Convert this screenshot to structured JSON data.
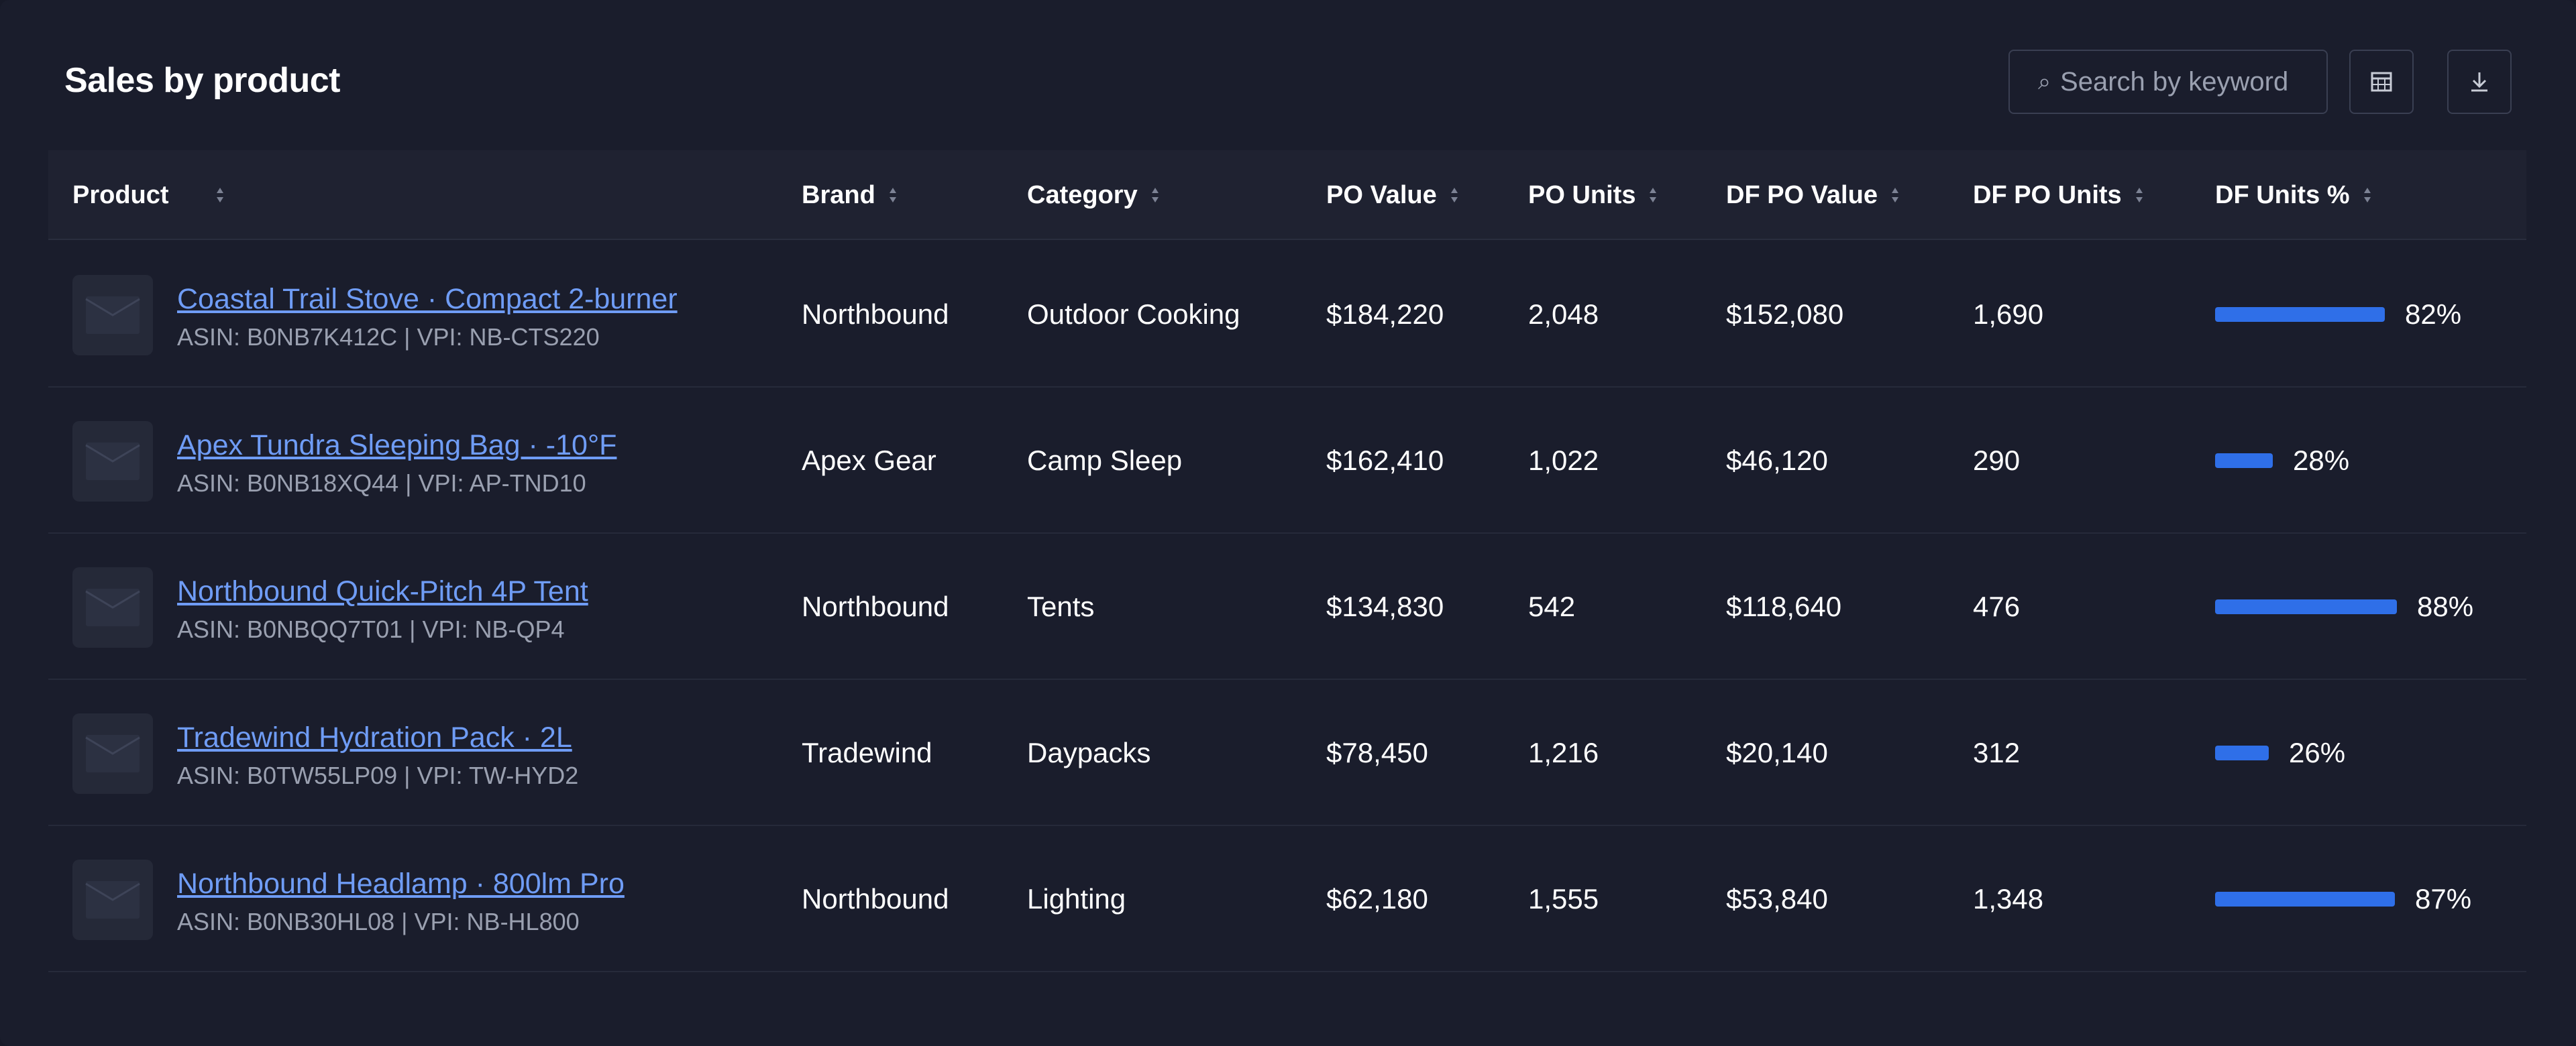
{
  "header": {
    "title": "Sales by product",
    "search_placeholder": "Search by keyword",
    "search_icon": "search-icon",
    "columns_icon": "columns-icon",
    "download_icon": "download-icon"
  },
  "columns": [
    {
      "label": "Product"
    },
    {
      "label": "Brand"
    },
    {
      "label": "Category"
    },
    {
      "label": "PO Value"
    },
    {
      "label": "PO Units"
    },
    {
      "label": "DF PO Value"
    },
    {
      "label": "DF PO Units"
    },
    {
      "label": "DF Units %"
    }
  ],
  "rows": [
    {
      "name": "Coastal Trail Stove · Compact 2-burner",
      "sub": "ASIN: B0NB7K412C | VPI: NB-CTS220",
      "brand": "Northbound",
      "category": "Outdoor Cooking",
      "po_value": "$184,220",
      "po_units": "2,048",
      "df_po_value": "$152,080",
      "df_po_units": "1,690",
      "df_units_pct": "82%",
      "df_units_frac": 0.82
    },
    {
      "name": "Apex Tundra Sleeping Bag · -10°F",
      "sub": "ASIN: B0NB18XQ44 | VPI: AP-TND10",
      "brand": "Apex Gear",
      "category": "Camp Sleep",
      "po_value": "$162,410",
      "po_units": "1,022",
      "df_po_value": "$46,120",
      "df_po_units": "290",
      "df_units_pct": "28%",
      "df_units_frac": 0.28
    },
    {
      "name": "Northbound Quick-Pitch 4P Tent",
      "sub": "ASIN: B0NBQQ7T01 | VPI: NB-QP4",
      "brand": "Northbound",
      "category": "Tents",
      "po_value": "$134,830",
      "po_units": "542",
      "df_po_value": "$118,640",
      "df_po_units": "476",
      "df_units_pct": "88%",
      "df_units_frac": 0.88
    },
    {
      "name": "Tradewind Hydration Pack · 2L",
      "sub": "ASIN: B0TW55LP09 | VPI: TW-HYD2",
      "brand": "Tradewind",
      "category": "Daypacks",
      "po_value": "$78,450",
      "po_units": "1,216",
      "df_po_value": "$20,140",
      "df_po_units": "312",
      "df_units_pct": "26%",
      "df_units_frac": 0.26
    },
    {
      "name": "Northbound Headlamp · 800lm Pro",
      "sub": "ASIN: B0NB30HL08 | VPI: NB-HL800",
      "brand": "Northbound",
      "category": "Lighting",
      "po_value": "$62,180",
      "po_units": "1,555",
      "df_po_value": "$53,840",
      "df_po_units": "1,348",
      "df_units_pct": "87%",
      "df_units_frac": 0.87
    }
  ],
  "colors": {
    "background": "#1a1d2c",
    "header_row": "#1f2231",
    "link": "#6f9cf5",
    "bar": "#2f6fe8",
    "muted_text": "#9aa0b0"
  }
}
